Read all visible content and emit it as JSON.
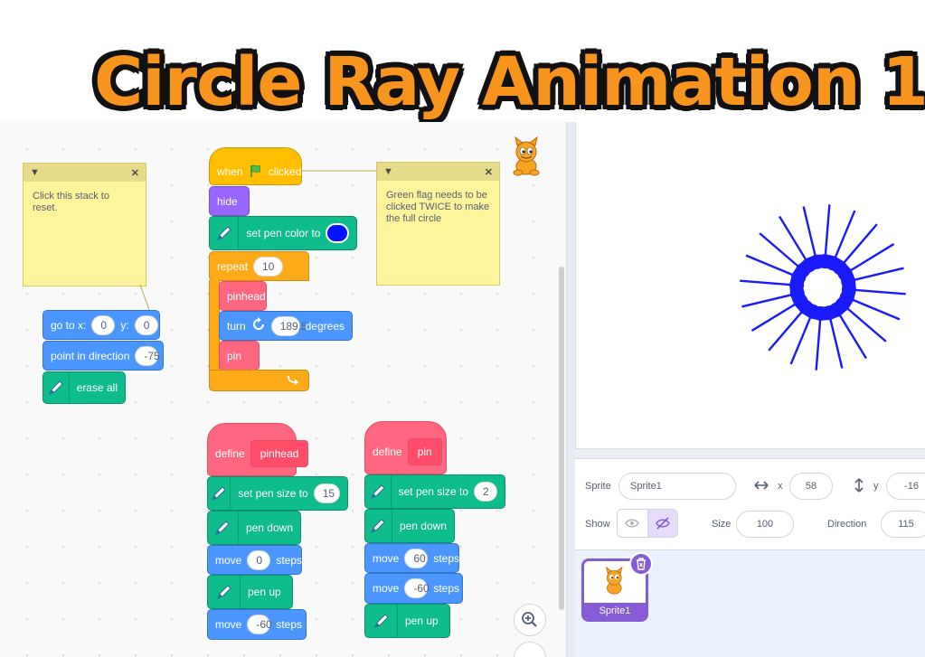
{
  "title": "Circle Ray Animation 1",
  "colors": {
    "title_orange": "#f7941d",
    "motion": "#4c97ff",
    "pen": "#0fbd8c",
    "looks": "#9966ff",
    "control": "#ffab19",
    "events": "#ffbf00",
    "my_blocks": "#ff6680",
    "pen_color_value": "#0014ff",
    "ray_color": "#1a1aff",
    "selection": "#855cd6"
  },
  "notes": {
    "reset": "Click this stack to reset.",
    "flag": "Green flag needs to be clicked TWICE to make the full circle",
    "collapse_icon": "triangle-down-icon",
    "close_icon": "close-icon"
  },
  "reset_stack": {
    "goto": {
      "label": "go to x:",
      "x": "0",
      "y_label": "y:",
      "y": "0"
    },
    "direction": {
      "label": "point in direction",
      "value": "-75"
    },
    "erase": "erase all"
  },
  "main_script": {
    "when": "when",
    "clicked": "clicked",
    "hide": "hide",
    "set_pen_color": "set pen color to",
    "repeat": "repeat",
    "repeat_count": "10",
    "pinhead": "pinhead",
    "turn": "turn",
    "turn_value": "189.5",
    "degrees": "degrees",
    "pin": "pin"
  },
  "define_pinhead": {
    "define": "define",
    "name": "pinhead",
    "set_size": "set pen size to",
    "size": "15",
    "pen_down": "pen down",
    "move": "move",
    "move1": "0",
    "steps": "steps",
    "pen_up": "pen up",
    "move2": "-60"
  },
  "define_pin": {
    "define": "define",
    "name": "pin",
    "set_size": "set pen size to",
    "size": "2",
    "pen_down": "pen down",
    "move": "move",
    "move1": "60",
    "steps": "steps",
    "move2": "-60",
    "pen_up": "pen up"
  },
  "sprite_info": {
    "sprite_label": "Sprite",
    "sprite_name": "Sprite1",
    "x_label": "x",
    "x": "58",
    "y_label": "y",
    "y": "-16",
    "show_label": "Show",
    "size_label": "Size",
    "size": "100",
    "direction_label": "Direction",
    "direction": "115"
  },
  "sprite_tile": {
    "name": "Sprite1"
  },
  "stage": {
    "ray_count": 20,
    "ring_points": 20
  }
}
